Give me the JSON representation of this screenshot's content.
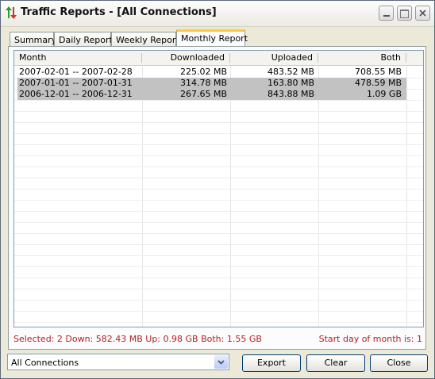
{
  "window": {
    "title": "Traffic Reports - [All Connections]"
  },
  "tabs": [
    {
      "label": "Summary"
    },
    {
      "label": "Daily Report"
    },
    {
      "label": "Weekly Report"
    },
    {
      "label": "Monthly Report"
    }
  ],
  "table": {
    "headers": [
      "Month",
      "Downloaded",
      "Uploaded",
      "Both"
    ],
    "rows": [
      {
        "month": "2007-02-01 -- 2007-02-28",
        "downloaded": "225.02 MB",
        "uploaded": "483.52 MB",
        "both": "708.55 MB",
        "selected": false
      },
      {
        "month": "2007-01-01 -- 2007-01-31",
        "downloaded": "314.78 MB",
        "uploaded": "163.80 MB",
        "both": "478.59 MB",
        "selected": true
      },
      {
        "month": "2006-12-01 -- 2006-12-31",
        "downloaded": "267.65 MB",
        "uploaded": "843.88 MB",
        "both": "1.09 GB",
        "selected": true
      }
    ]
  },
  "status": {
    "summary": "Selected: 2   Down: 582.43 MB   Up: 0.98 GB   Both: 1.55 GB",
    "start_day": "Start day of month is: 1"
  },
  "connection_select": {
    "value": "All Connections"
  },
  "buttons": {
    "export": "Export",
    "clear": "Clear",
    "close": "Close"
  }
}
